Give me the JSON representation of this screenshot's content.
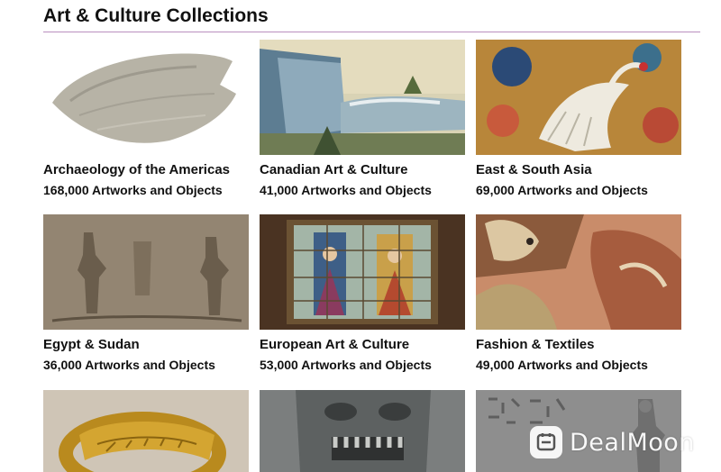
{
  "page": {
    "title": "Art & Culture Collections"
  },
  "collections": [
    {
      "title": "Archaeology of the Americas",
      "count": "168,000 Artworks and Objects"
    },
    {
      "title": "Canadian Art & Culture",
      "count": "41,000 Artworks and Objects"
    },
    {
      "title": "East & South Asia",
      "count": "69,000 Artworks and Objects"
    },
    {
      "title": "Egypt & Sudan",
      "count": "36,000 Artworks and Objects"
    },
    {
      "title": "European Art & Culture",
      "count": "53,000 Artworks and Objects"
    },
    {
      "title": "Fashion & Textiles",
      "count": "49,000 Artworks and Objects"
    }
  ],
  "watermark": {
    "text": "DealMoon"
  }
}
